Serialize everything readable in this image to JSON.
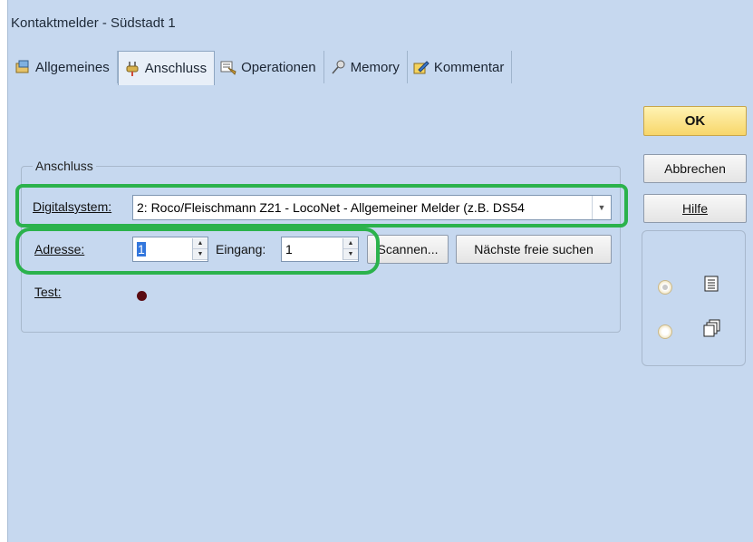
{
  "window": {
    "title": "Kontaktmelder - Südstadt 1"
  },
  "tabs": [
    {
      "label": "Allgemeines",
      "icon": "general-properties-icon"
    },
    {
      "label": "Anschluss",
      "icon": "plug-icon"
    },
    {
      "label": "Operationen",
      "icon": "operations-icon"
    },
    {
      "label": "Memory",
      "icon": "pin-icon"
    },
    {
      "label": "Kommentar",
      "icon": "comment-pencil-icon"
    }
  ],
  "buttons": {
    "ok": "OK",
    "cancel": "Abbrechen",
    "help": "Hilfe"
  },
  "group": {
    "label": "Anschluss"
  },
  "digitalsystem": {
    "label": "Digitalsystem:",
    "value": "2: Roco/Fleischmann Z21 - LocoNet - Allgemeiner Melder (z.B. DS54"
  },
  "adresse": {
    "label": "Adresse:",
    "value": "1"
  },
  "eingang": {
    "label": "Eingang:",
    "value": "1"
  },
  "scan_button": "Scannen...",
  "next_free_button": "Nächste freie suchen",
  "test": {
    "label": "Test:"
  },
  "colors": {
    "background": "#c6d8ef",
    "highlight": "#2bb24c",
    "ok_button": "#f7d66a",
    "led": "#5a0b12"
  }
}
